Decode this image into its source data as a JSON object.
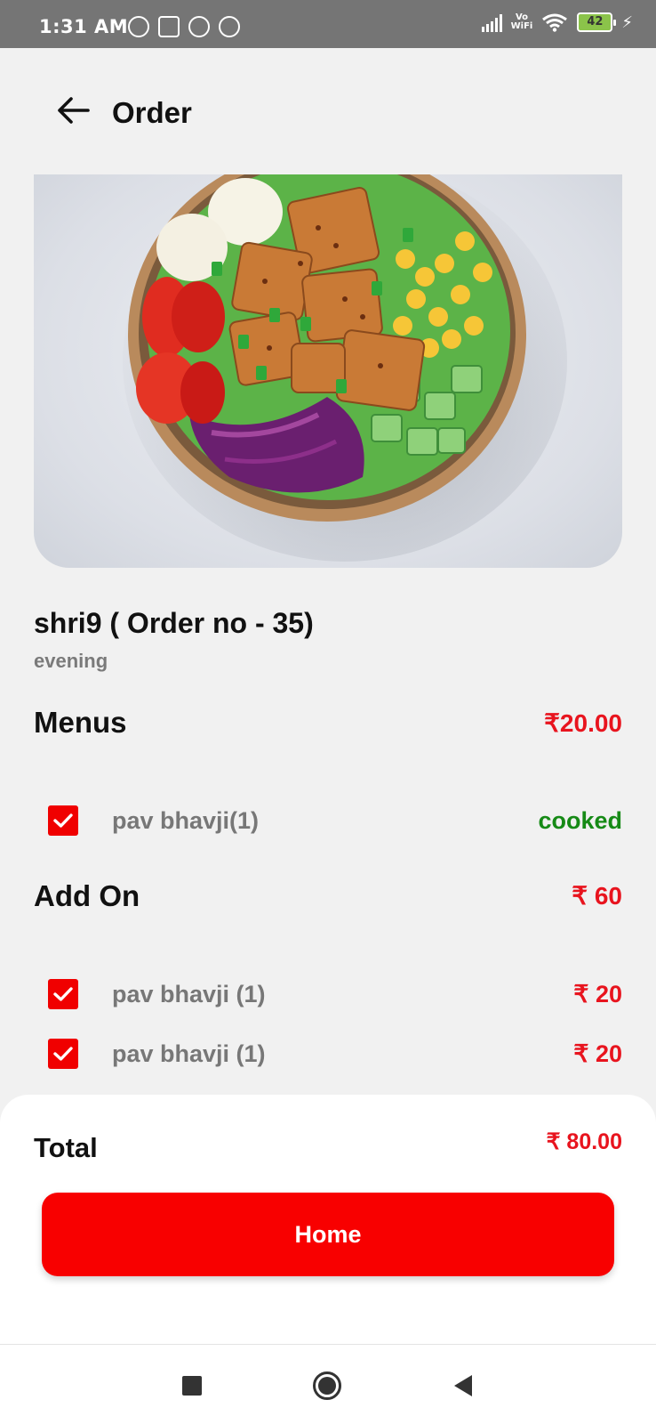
{
  "status_bar": {
    "time": "1:31 AM",
    "notification_icons": [
      "alarm-icon",
      "usb-icon",
      "app-notification-icon",
      "app-notification-icon"
    ],
    "vowifi_top": "Vo",
    "vowifi_bottom": "WiFi",
    "battery": "42"
  },
  "app_bar": {
    "title": "Order",
    "back_icon": "arrow-left-icon"
  },
  "order": {
    "title": "shri9 ( Order no - 35)",
    "subtitle": "evening"
  },
  "menus": {
    "heading": "Menus",
    "price": "₹20.00",
    "items": [
      {
        "label": "pav bhavji(1)",
        "status": "cooked",
        "checked": true
      }
    ]
  },
  "add_on": {
    "heading": "Add On",
    "price": "₹ 60",
    "items": [
      {
        "label": "pav bhavji (1)",
        "price": "₹ 20",
        "checked": true
      },
      {
        "label": "pav bhavji (1)",
        "price": "₹ 20",
        "checked": true
      }
    ]
  },
  "summary": {
    "total_label": "Total",
    "total_value": "₹ 80.00",
    "home_button": "Home"
  },
  "colors": {
    "accent_red": "#f80000",
    "price_red": "#e8141e",
    "status_green": "#168a16",
    "background": "#f1f1f1"
  },
  "nav_bar": {
    "icons": [
      "recents-square-icon",
      "home-circle-icon",
      "back-triangle-icon"
    ]
  }
}
